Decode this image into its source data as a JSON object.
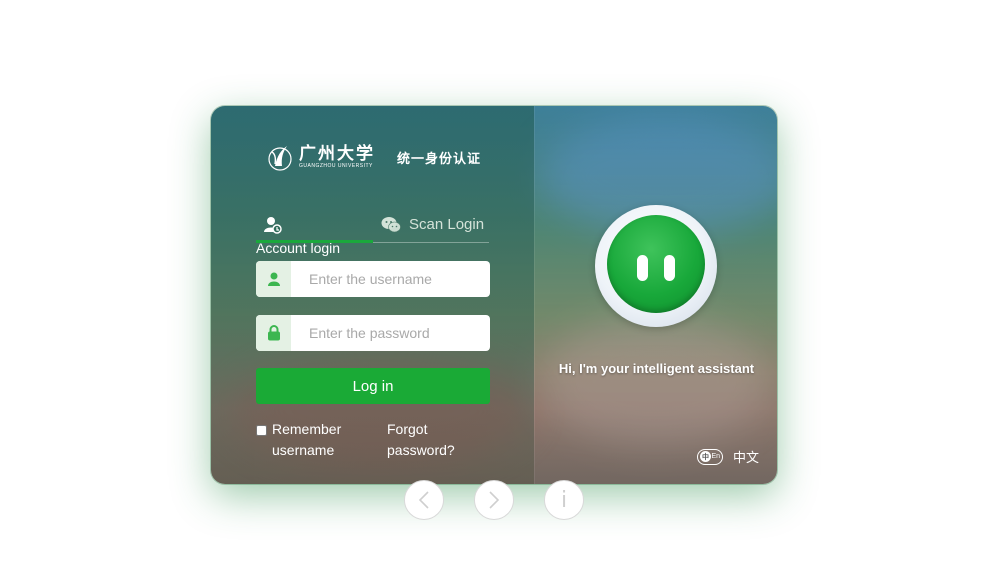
{
  "brand": {
    "name_cn": "广州大学",
    "name_en": "GUANGZHOU UNIVERSITY",
    "subtitle": "统一身份认证"
  },
  "tabs": [
    {
      "label": "",
      "icon": "user-icon",
      "active": true
    },
    {
      "label": "Scan Login",
      "icon": "wechat-icon",
      "active": false
    }
  ],
  "form": {
    "section_label": "Account login",
    "username_placeholder": "Enter the username",
    "username_value": "",
    "password_placeholder": "Enter the password",
    "password_value": "",
    "login_label": "Log in",
    "remember_label": "Remember username",
    "forgot_label": "Forgot password?"
  },
  "assistant": {
    "greeting": "Hi, I'm your intelligent assistant"
  },
  "language": {
    "toggle_left": "中",
    "toggle_right": "En",
    "label": "中文"
  },
  "carousel": {
    "prev_icon": "chevron-left-icon",
    "next_icon": "chevron-right-icon",
    "info_label": "i"
  },
  "colors": {
    "accent": "#1aaa36",
    "field_prefix": "#e4f1e4"
  }
}
